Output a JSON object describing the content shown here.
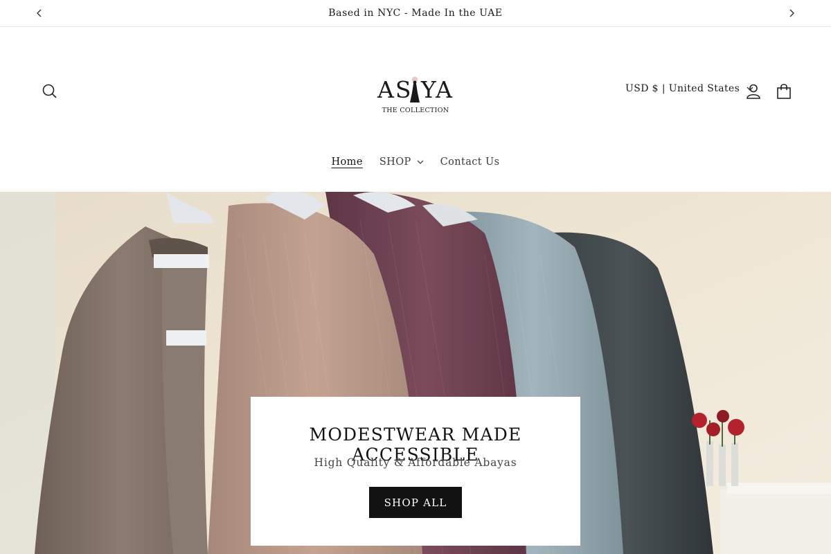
{
  "announcement": {
    "text": "Based in NYC - Made In the UAE"
  },
  "header": {
    "logo_main": "AS YA",
    "logo_sub": "THE COLLECTION",
    "currency": "USD $ | United States",
    "icons": {
      "search": "search-icon",
      "account": "user-icon",
      "cart": "cart-icon"
    }
  },
  "nav": {
    "items": [
      {
        "label": "Home",
        "active": true
      },
      {
        "label": "SHOP",
        "has_dropdown": true
      },
      {
        "label": "Contact Us"
      }
    ]
  },
  "hero": {
    "title": "MODESTWEAR MADE ACCESSIBLE",
    "subtitle": "High Quality & Affordable Abayas",
    "button": "SHOP ALL"
  },
  "colors": {
    "button_bg": "#121212",
    "text": "#121212"
  }
}
